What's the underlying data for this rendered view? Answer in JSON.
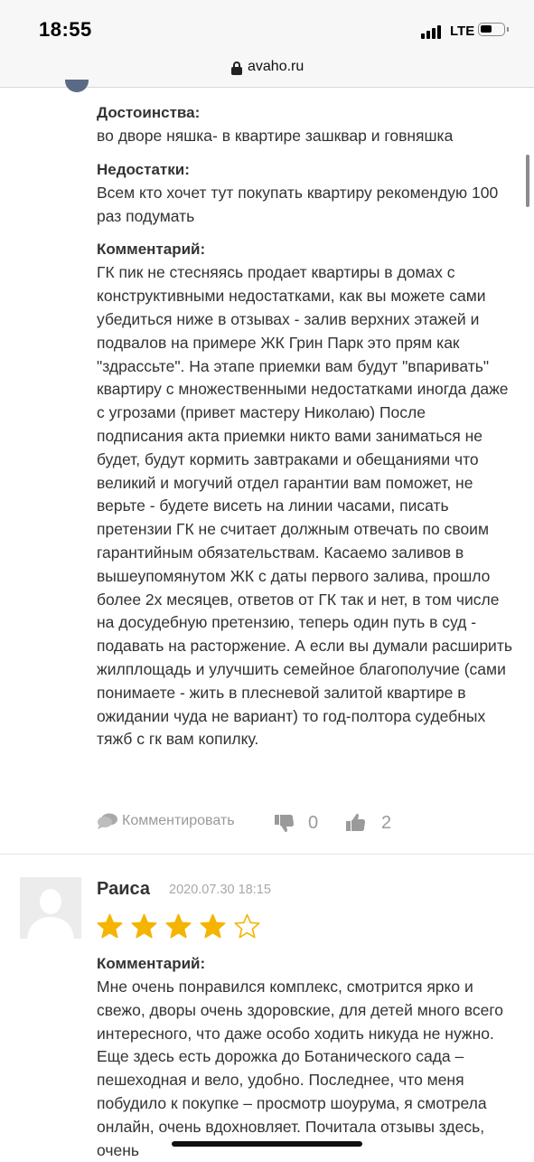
{
  "status_bar": {
    "time": "18:55",
    "network": "LTE"
  },
  "browser": {
    "url": "avaho.ru"
  },
  "review1": {
    "pros_label": "Достоинства:",
    "pros_text": "во дворе няшка- в квартире зашквар и говняшка",
    "cons_label": "Недостатки:",
    "cons_text": "Всем кто хочет тут покупать квартиру рекомендую 100 раз подумать",
    "comment_label": "Комментарий:",
    "comment_text": "ГК пик не стесняясь продает квартиры в домах с конструктивными недостатками, как вы можете сами убедиться ниже в отзывах  - залив верхних этажей и подвалов на примере ЖК Грин Парк это прям как \"здрассьте\". На этапе приемки вам будут \"впаривать\" квартиру с множественными недостатками иногда даже с угрозами (привет мастеру Николаю) После подписания акта приемки никто вами заниматься не будет, будут кормить завтраками и обещаниями что великий и могучий отдел гарантии вам поможет, не верьте - будете висеть на линии часами, писать претензии ГК не считает должным отвечать по своим гарантийным обязательствам. Касаемо заливов в вышеупомянутом ЖК с даты первого залива, прошло более 2х месяцев, ответов от ГК так и нет, в том числе на досудебную претензию, теперь один путь в суд - подавать на расторжение. А если вы думали расширить жилплощадь и улучшить семейное благополучие (сами понимаете  - жить в плесневой залитой квартире в ожидании чуда не вариант) то год-полтора судебных тяжб с гк вам копилку.",
    "comment_action": "Комментировать",
    "dislikes": "0",
    "likes": "2"
  },
  "review2": {
    "author": "Раиса",
    "date": "2020.07.30 18:15",
    "rating": 4,
    "rating_max": 5,
    "comment_label": "Комментарий:",
    "comment_text": "Мне очень понравился комплекс, смотрится ярко и свежо, дворы очень здоровские, для детей много всего интересного, что даже особо ходить никуда не нужно. Еще здесь есть дорожка до Ботанического сада – пешеходная и вело, удобно. Последнее, что меня побудило к покупке – просмотр шоурума, я смотрела онлайн, очень вдохновляет. Почитала отзывы здесь, очень"
  },
  "colors": {
    "star": "#f4b400",
    "muted": "#9a9a9a",
    "text": "#333333"
  },
  "icons": [
    "lock-icon",
    "comment-icon",
    "thumbs-down-icon",
    "thumbs-up-icon",
    "star-icon",
    "user-placeholder-icon"
  ]
}
